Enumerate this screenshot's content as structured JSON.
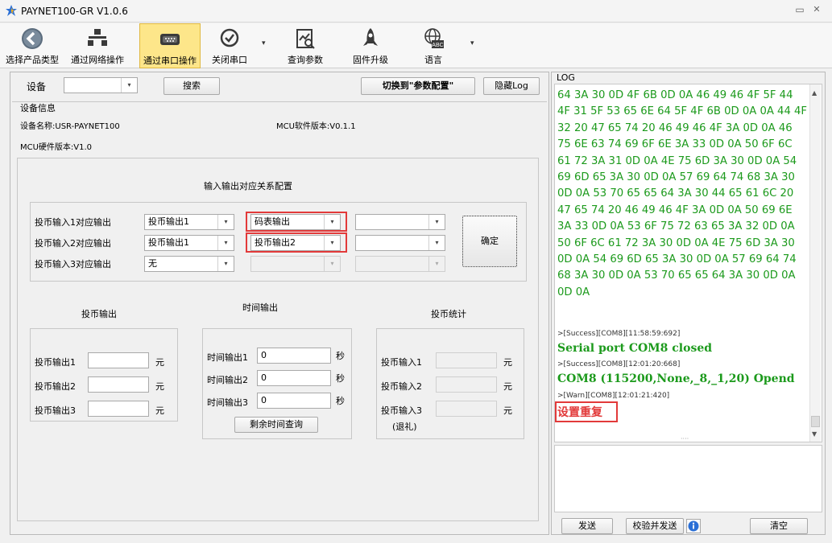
{
  "window": {
    "title": "PAYNET100-GR  V1.0.6",
    "minimize": "▭",
    "close": "✕"
  },
  "toolbar": {
    "items": [
      {
        "label": "选择产品类型"
      },
      {
        "label": "通过网络操作"
      },
      {
        "label": "通过串口操作"
      },
      {
        "label": "关闭串口"
      },
      {
        "label": "查询参数"
      },
      {
        "label": "固件升级"
      },
      {
        "label": "语言"
      }
    ]
  },
  "top": {
    "device_label": "设备",
    "search_btn": "搜索",
    "switch_btn": "切换到\"参数配置\"",
    "hide_log_btn": "隐藏Log"
  },
  "info": {
    "section_title": "设备信息",
    "device_name": "设备名称:USR-PAYNET100",
    "mcu_sw": "MCU软件版本:V0.1.1",
    "mcu_hw": "MCU硬件版本:V1.0"
  },
  "io_config": {
    "title": "输入输出对应关系配置",
    "rows": [
      {
        "label": "投币输入1对应输出",
        "sel1": "投币输出1",
        "sel2": "码表输出",
        "sel3": ""
      },
      {
        "label": "投币输入2对应输出",
        "sel1": "投币输出1",
        "sel2": "投币输出2",
        "sel3": ""
      },
      {
        "label": "投币输入3对应输出",
        "sel1": "无",
        "sel2": "",
        "sel3": ""
      }
    ],
    "confirm_btn": "确定"
  },
  "coin_out": {
    "title": "投币输出",
    "rows": [
      {
        "label": "投币输出1",
        "value": "",
        "unit": "元"
      },
      {
        "label": "投币输出2",
        "value": "",
        "unit": "元"
      },
      {
        "label": "投币输出3",
        "value": "",
        "unit": "元"
      }
    ]
  },
  "time_out": {
    "title": "时间输出",
    "rows": [
      {
        "label": "时间输出1",
        "value": "0",
        "unit": "秒"
      },
      {
        "label": "时间输出2",
        "value": "0",
        "unit": "秒"
      },
      {
        "label": "时间输出3",
        "value": "0",
        "unit": "秒"
      }
    ],
    "query_btn": "剩余时间查询"
  },
  "coin_stats": {
    "title": "投币统计",
    "rows": [
      {
        "label": "投币输入1",
        "value": "",
        "unit": "元"
      },
      {
        "label": "投币输入2",
        "value": "",
        "unit": "元"
      },
      {
        "label": "投币输入3",
        "value": "",
        "unit": "元"
      }
    ],
    "note": "(退礼)"
  },
  "log": {
    "title": "LOG",
    "hex_lines": [
      "64 3A 30 0D 4F 6B 0D 0A 46 49 46 4F 5F 44",
      "4F 31 5F 53 65 6E 64 5F 4F 6B 0D 0A 0A 44 4F",
      "32 20 47 65 74 20 46 49 46 4F 3A 0D 0A 46",
      "75 6E 63 74 69 6F 6E 3A 33 0D 0A 50 6F 6C",
      "61 72 3A 31 0D 0A 4E 75 6D 3A 30 0D 0A 54",
      "69 6D 65 3A 30 0D 0A 57 69 64 74 68 3A 30",
      "0D 0A 53 70 65 65 64 3A 30 44 65 61 6C 20",
      "47 65 74 20 46 49 46 4F 3A 0D 0A 50 69 6E",
      "3A 33 0D 0A 53 6F 75 72 63 65 3A 32 0D 0A",
      "50 6F 6C 61 72 3A 30 0D 0A 4E 75 6D 3A 30",
      "0D 0A 54 69 6D 65 3A 30 0D 0A 57 69 64 74",
      "68 3A 30 0D 0A 53 70 65 65 64 3A 30 0D 0A",
      "0D 0A"
    ],
    "entry1_meta": ">[Success][COM8][11:58:59:692]",
    "entry1_msg": "Serial port COM8 closed",
    "entry2_meta": ">[Success][COM8][12:01:20:668]",
    "entry2_msg": "COM8 (115200,None,_8,_1,20) Opend",
    "entry3_meta": ">[Warn][COM8][12:01:21:420]",
    "entry3_msg": "设置重复",
    "send_btn": "发送",
    "verify_send_btn": "校验并发送",
    "clear_btn": "清空",
    "splitter": "····"
  },
  "colors": {
    "log_green": "#1c9a1c",
    "warn_red": "#e23a3a",
    "highlight": "#fde68a"
  }
}
